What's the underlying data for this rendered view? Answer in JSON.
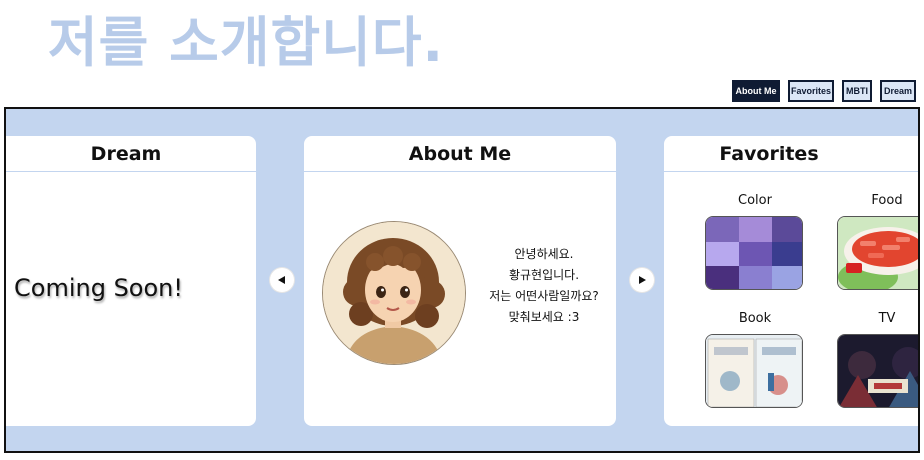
{
  "site": {
    "title": "저를 소개합니다."
  },
  "nav": {
    "items": [
      {
        "label": "About Me",
        "active": true
      },
      {
        "label": "Favorites",
        "active": false
      },
      {
        "label": "MBTI",
        "active": false
      },
      {
        "label": "Dream",
        "active": false
      }
    ]
  },
  "carousel": {
    "dream": {
      "title": "Dream",
      "body": "Coming Soon!"
    },
    "about": {
      "title": "About Me",
      "bio_lines": [
        "안녕하세요.",
        "황규현입니다.",
        "저는 어떤사람일까요?",
        "맞춰보세요 :3"
      ]
    },
    "favorites": {
      "title": "Favorites",
      "items": [
        {
          "label": "Color"
        },
        {
          "label": "Food"
        },
        {
          "label": "Book"
        },
        {
          "label": "TV"
        }
      ]
    },
    "prev_icon": "triangle-left",
    "next_icon": "triangle-right"
  },
  "colors": {
    "title": "#b7cbe9",
    "frame_bg": "#c3d5ef",
    "nav_dark": "#0f1b33",
    "nav_light": "#dbe6f6"
  }
}
